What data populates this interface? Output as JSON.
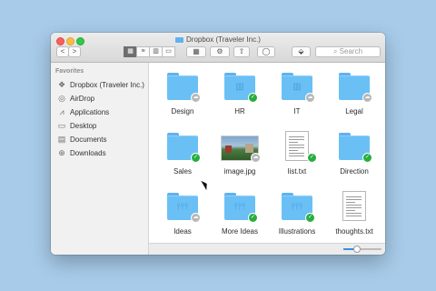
{
  "window": {
    "title": "Dropbox (Traveler Inc.)",
    "search_placeholder": "Search"
  },
  "toolbar": {
    "back_label": "<",
    "forward_label": ">",
    "view_modes": [
      "▦",
      "≡",
      "▥",
      "▭"
    ],
    "active_view": 0,
    "arrange_label": "▦",
    "action_label": "⚙",
    "share_label": "⇧",
    "tag_label": "◯",
    "dropbox_label": "⬙"
  },
  "sidebar": {
    "heading": "Favorites",
    "items": [
      {
        "label": "Dropbox (Traveler Inc.)",
        "icon": "dropbox-icon"
      },
      {
        "label": "AirDrop",
        "icon": "airdrop-icon"
      },
      {
        "label": "Applications",
        "icon": "applications-icon"
      },
      {
        "label": "Desktop",
        "icon": "desktop-icon"
      },
      {
        "label": "Documents",
        "icon": "documents-icon"
      },
      {
        "label": "Downloads",
        "icon": "downloads-icon"
      }
    ]
  },
  "files": [
    {
      "name": "Design",
      "kind": "folder",
      "glyph": "",
      "status": "cloud"
    },
    {
      "name": "HR",
      "kind": "folder",
      "glyph": "▥",
      "status": "synced"
    },
    {
      "name": "IT",
      "kind": "folder",
      "glyph": "▥",
      "status": "cloud"
    },
    {
      "name": "Legal",
      "kind": "folder",
      "glyph": "",
      "status": "cloud"
    },
    {
      "name": "Sales",
      "kind": "folder",
      "glyph": "",
      "status": "synced"
    },
    {
      "name": "image.jpg",
      "kind": "image",
      "glyph": "",
      "status": "cloud"
    },
    {
      "name": "list.txt",
      "kind": "text",
      "glyph": "",
      "status": "synced"
    },
    {
      "name": "Direction",
      "kind": "folder",
      "glyph": "",
      "status": "synced"
    },
    {
      "name": "Ideas",
      "kind": "folder",
      "glyph": "⫯⫯⫯",
      "status": "cloud"
    },
    {
      "name": "More Ideas",
      "kind": "folder",
      "glyph": "⫯⫯⫯",
      "status": "synced"
    },
    {
      "name": "Illustrations",
      "kind": "folder",
      "glyph": "⫯⫯⫯",
      "status": "synced"
    },
    {
      "name": "thoughts.txt",
      "kind": "text",
      "glyph": "",
      "status": "none"
    }
  ],
  "status_symbols": {
    "synced": "✓",
    "cloud": "☁"
  },
  "colors": {
    "accent": "#3a8ee6",
    "folder": "#6ac0f5",
    "synced_badge": "#27ae3e",
    "cloud_badge": "#b8b8b8"
  }
}
